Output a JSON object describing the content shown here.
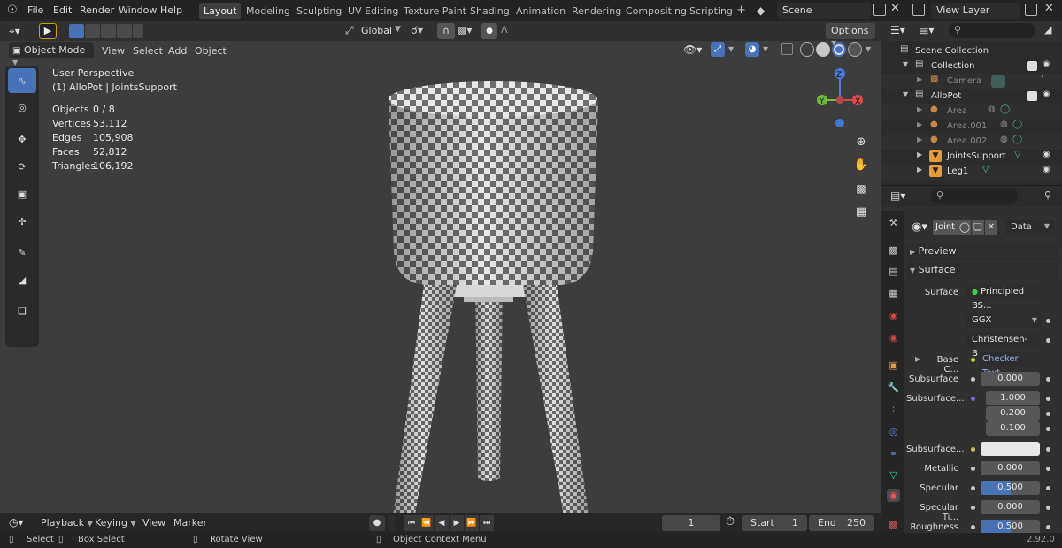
{
  "menu": {
    "file": "File",
    "edit": "Edit",
    "render": "Render",
    "window": "Window",
    "help": "Help"
  },
  "workspaces": [
    "Layout",
    "Modeling",
    "Sculpting",
    "UV Editing",
    "Texture Paint",
    "Shading",
    "Animation",
    "Rendering",
    "Compositing",
    "Scripting"
  ],
  "active_workspace": "Layout",
  "add_workspace": "+",
  "scene": {
    "label": "Scene",
    "view_layer": "View Layer"
  },
  "viewport_header": {
    "mode": "Object Mode",
    "view": "View",
    "select": "Select",
    "add": "Add",
    "object": "Object",
    "orientation": "Global",
    "options": "Options"
  },
  "overlay": {
    "perspective": "User Perspective",
    "context": "(1) AlloPot | JointsSupport"
  },
  "stats": [
    {
      "label": "Objects",
      "value": "0 / 8"
    },
    {
      "label": "Vertices",
      "value": "53,112"
    },
    {
      "label": "Edges",
      "value": "105,908"
    },
    {
      "label": "Faces",
      "value": "52,812"
    },
    {
      "label": "Triangles",
      "value": "106,192"
    }
  ],
  "gizmo": {
    "z": "Z",
    "x": "X",
    "y": "Y"
  },
  "outliner": {
    "rows": [
      {
        "label": "Scene Collection",
        "indent": 0
      },
      {
        "label": "Collection",
        "indent": 1
      },
      {
        "label": "Camera",
        "indent": 2
      },
      {
        "label": "AlloPot",
        "indent": 1
      },
      {
        "label": "Area",
        "indent": 2
      },
      {
        "label": "Area.001",
        "indent": 2
      },
      {
        "label": "Area.002",
        "indent": 2
      },
      {
        "label": "JointsSupport",
        "indent": 2
      },
      {
        "label": "Leg1",
        "indent": 2
      }
    ]
  },
  "properties": {
    "material_name": "Joint",
    "data": "Data",
    "preview": "Preview",
    "surface_panel": "Surface",
    "surface_label": "Surface",
    "surface_value": "Principled BS...",
    "distribution": "GGX",
    "subsurface_method": "Christensen-B...",
    "base_color_label": "Base C...",
    "base_color_value": "Checker Text...",
    "subsurface_label": "Subsurface",
    "subsurface_value": "0.000",
    "subsurface_radius_label": "Subsurface...",
    "radius_1": "1.000",
    "radius_2": "0.200",
    "radius_3": "0.100",
    "subsurface_color_label": "Subsurface...",
    "metallic_label": "Metallic",
    "metallic_value": "0.000",
    "specular_label": "Specular",
    "specular_value": "0.500",
    "specular_value_fraction": 0.5,
    "spec_tint_label": "Specular Ti...",
    "spec_tint_value": "0.000",
    "roughness_label": "Roughness",
    "roughness_value": "0.500",
    "roughness_value_fraction": 0.5
  },
  "timeline": {
    "playback": "Playback",
    "keying": "Keying",
    "view": "View",
    "marker": "Marker",
    "current_frame": "1",
    "start_label": "Start",
    "start_value": "1",
    "end_label": "End",
    "end_value": "250"
  },
  "statusbar": {
    "select": "Select",
    "box_select": "Box Select",
    "rotate": "Rotate View",
    "context_menu": "Object Context Menu",
    "version": "2.92.0"
  },
  "colors": {
    "accent": "#4872b9",
    "outliner_bg": "#2b2b2b",
    "viewport_bg": "#3d3d3d"
  }
}
